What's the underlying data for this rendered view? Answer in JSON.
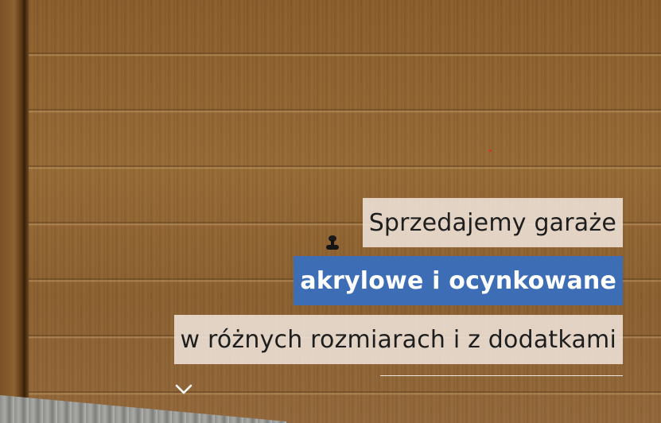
{
  "hero": {
    "line1": "Sprzedajemy garaże",
    "line2": "akrylowe i ocynkowane",
    "line3": "w różnych rozmiarach i z dodatkami"
  },
  "colors": {
    "accent_blue": "#3d6eb5",
    "light_box": "#eee2d8",
    "wood": "#8b5d2b"
  },
  "icons": {
    "scroll": "chevron-down-icon"
  }
}
